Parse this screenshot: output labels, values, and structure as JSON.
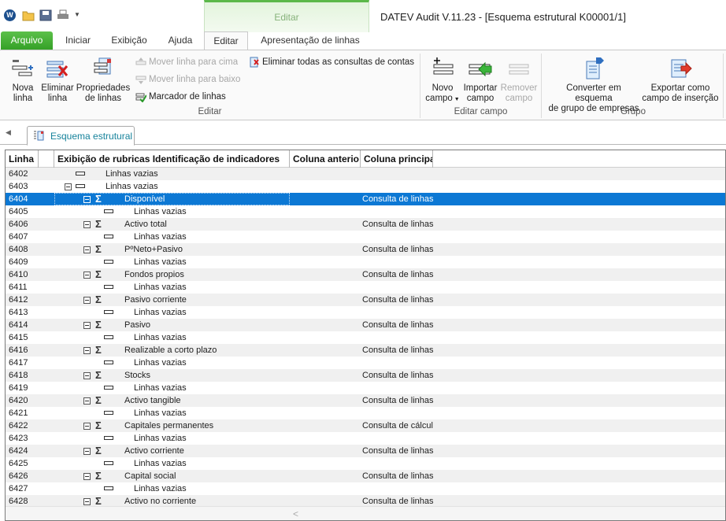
{
  "app": {
    "logo_letter": "W",
    "window_title": "DATEV Audit V.11.23 - [Esquema estrutural K00001/1]",
    "context_tab_group": "Editar"
  },
  "ribbon_tabs": {
    "arquivo": "Arquivo",
    "iniciar": "Iniciar",
    "exibicao": "Exibição",
    "ajuda": "Ajuda",
    "editar": "Editar",
    "apresentacao": "Apresentação de linhas"
  },
  "ribbon": {
    "nova_linha": [
      "Nova",
      "linha"
    ],
    "eliminar_linha": [
      "Eliminar",
      "linha"
    ],
    "propriedades_linhas": [
      "Propriedades",
      "de linhas"
    ],
    "mover_cima": "Mover linha para cima",
    "mover_baixo": "Mover linha para baixo",
    "marcador": "Marcador de linhas",
    "eliminar_consultas": "Eliminar todas as consultas de contas",
    "group_editar": "Editar",
    "novo_campo": [
      "Novo",
      "campo"
    ],
    "importar_campo": [
      "Importar",
      "campo"
    ],
    "remover_campo": [
      "Remover",
      "campo"
    ],
    "group_editar_campo": "Editar campo",
    "converter": [
      "Converter em esquema",
      "de grupo de empresas"
    ],
    "exportar": [
      "Exportar como",
      "campo de inserção"
    ],
    "group_grupo": "Grupo"
  },
  "document_tab": {
    "label": "Esquema estrutural"
  },
  "grid": {
    "columns": [
      "Linha",
      "",
      "Exibição de rubricas Identificação de indicadores",
      "Coluna anterio",
      "Coluna principa"
    ],
    "rows": [
      {
        "num": "6402",
        "label": "Linhas vazias",
        "kind": "empty-top",
        "col": ""
      },
      {
        "num": "6403",
        "label": "Linhas vazias",
        "kind": "empty-top-exp",
        "col": ""
      },
      {
        "num": "6404",
        "label": "Disponível",
        "kind": "sum",
        "col": "Consulta de linhas",
        "selected": true
      },
      {
        "num": "6405",
        "label": "Linhas vazias",
        "kind": "empty",
        "col": ""
      },
      {
        "num": "6406",
        "label": "Activo total",
        "kind": "sum",
        "col": "Consulta de linhas"
      },
      {
        "num": "6407",
        "label": "Linhas vazias",
        "kind": "empty",
        "col": ""
      },
      {
        "num": "6408",
        "label": "PºNeto+Pasivo",
        "kind": "sum",
        "col": "Consulta de linhas"
      },
      {
        "num": "6409",
        "label": "Linhas vazias",
        "kind": "empty",
        "col": ""
      },
      {
        "num": "6410",
        "label": "Fondos propios",
        "kind": "sum",
        "col": "Consulta de linhas"
      },
      {
        "num": "6411",
        "label": "Linhas vazias",
        "kind": "empty",
        "col": ""
      },
      {
        "num": "6412",
        "label": "Pasivo corriente",
        "kind": "sum",
        "col": "Consulta de linhas"
      },
      {
        "num": "6413",
        "label": "Linhas vazias",
        "kind": "empty",
        "col": ""
      },
      {
        "num": "6414",
        "label": "Pasivo",
        "kind": "sum",
        "col": "Consulta de linhas"
      },
      {
        "num": "6415",
        "label": "Linhas vazias",
        "kind": "empty",
        "col": ""
      },
      {
        "num": "6416",
        "label": "Realizable a corto plazo",
        "kind": "sum",
        "col": "Consulta de linhas"
      },
      {
        "num": "6417",
        "label": "Linhas vazias",
        "kind": "empty",
        "col": ""
      },
      {
        "num": "6418",
        "label": "Stocks",
        "kind": "sum",
        "col": "Consulta de linhas"
      },
      {
        "num": "6419",
        "label": "Linhas vazias",
        "kind": "empty",
        "col": ""
      },
      {
        "num": "6420",
        "label": "Activo tangible",
        "kind": "sum",
        "col": "Consulta de linhas"
      },
      {
        "num": "6421",
        "label": "Linhas vazias",
        "kind": "empty",
        "col": ""
      },
      {
        "num": "6422",
        "label": "Capitales permanentes",
        "kind": "sum",
        "col": "Consulta de cálcul"
      },
      {
        "num": "6423",
        "label": "Linhas vazias",
        "kind": "empty",
        "col": ""
      },
      {
        "num": "6424",
        "label": "Activo corriente",
        "kind": "sum",
        "col": "Consulta de linhas"
      },
      {
        "num": "6425",
        "label": "Linhas vazias",
        "kind": "empty",
        "col": ""
      },
      {
        "num": "6426",
        "label": "Capital social",
        "kind": "sum",
        "col": "Consulta de linhas"
      },
      {
        "num": "6427",
        "label": "Linhas vazias",
        "kind": "empty",
        "col": ""
      },
      {
        "num": "6428",
        "label": "Activo no corriente",
        "kind": "sum",
        "col": "Consulta de linhas"
      }
    ]
  },
  "colors": {
    "accent_green": "#35a127",
    "selection_blue": "#0c78d4",
    "doc_tab_text": "#16829b"
  }
}
